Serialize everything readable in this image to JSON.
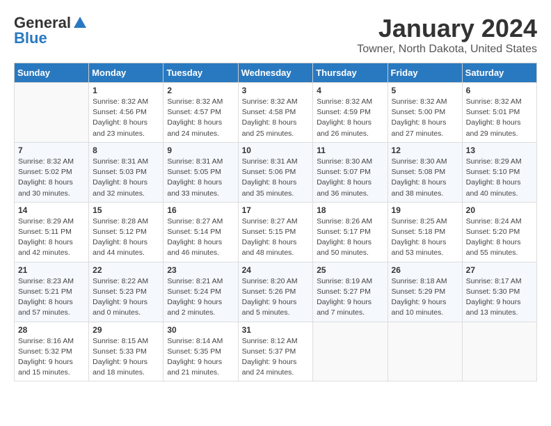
{
  "header": {
    "logo_line1": "General",
    "logo_line2": "Blue",
    "month": "January 2024",
    "location": "Towner, North Dakota, United States"
  },
  "weekdays": [
    "Sunday",
    "Monday",
    "Tuesday",
    "Wednesday",
    "Thursday",
    "Friday",
    "Saturday"
  ],
  "weeks": [
    [
      {
        "day": "",
        "sunrise": "",
        "sunset": "",
        "daylight": ""
      },
      {
        "day": "1",
        "sunrise": "Sunrise: 8:32 AM",
        "sunset": "Sunset: 4:56 PM",
        "daylight": "Daylight: 8 hours and 23 minutes."
      },
      {
        "day": "2",
        "sunrise": "Sunrise: 8:32 AM",
        "sunset": "Sunset: 4:57 PM",
        "daylight": "Daylight: 8 hours and 24 minutes."
      },
      {
        "day": "3",
        "sunrise": "Sunrise: 8:32 AM",
        "sunset": "Sunset: 4:58 PM",
        "daylight": "Daylight: 8 hours and 25 minutes."
      },
      {
        "day": "4",
        "sunrise": "Sunrise: 8:32 AM",
        "sunset": "Sunset: 4:59 PM",
        "daylight": "Daylight: 8 hours and 26 minutes."
      },
      {
        "day": "5",
        "sunrise": "Sunrise: 8:32 AM",
        "sunset": "Sunset: 5:00 PM",
        "daylight": "Daylight: 8 hours and 27 minutes."
      },
      {
        "day": "6",
        "sunrise": "Sunrise: 8:32 AM",
        "sunset": "Sunset: 5:01 PM",
        "daylight": "Daylight: 8 hours and 29 minutes."
      }
    ],
    [
      {
        "day": "7",
        "sunrise": "Sunrise: 8:32 AM",
        "sunset": "Sunset: 5:02 PM",
        "daylight": "Daylight: 8 hours and 30 minutes."
      },
      {
        "day": "8",
        "sunrise": "Sunrise: 8:31 AM",
        "sunset": "Sunset: 5:03 PM",
        "daylight": "Daylight: 8 hours and 32 minutes."
      },
      {
        "day": "9",
        "sunrise": "Sunrise: 8:31 AM",
        "sunset": "Sunset: 5:05 PM",
        "daylight": "Daylight: 8 hours and 33 minutes."
      },
      {
        "day": "10",
        "sunrise": "Sunrise: 8:31 AM",
        "sunset": "Sunset: 5:06 PM",
        "daylight": "Daylight: 8 hours and 35 minutes."
      },
      {
        "day": "11",
        "sunrise": "Sunrise: 8:30 AM",
        "sunset": "Sunset: 5:07 PM",
        "daylight": "Daylight: 8 hours and 36 minutes."
      },
      {
        "day": "12",
        "sunrise": "Sunrise: 8:30 AM",
        "sunset": "Sunset: 5:08 PM",
        "daylight": "Daylight: 8 hours and 38 minutes."
      },
      {
        "day": "13",
        "sunrise": "Sunrise: 8:29 AM",
        "sunset": "Sunset: 5:10 PM",
        "daylight": "Daylight: 8 hours and 40 minutes."
      }
    ],
    [
      {
        "day": "14",
        "sunrise": "Sunrise: 8:29 AM",
        "sunset": "Sunset: 5:11 PM",
        "daylight": "Daylight: 8 hours and 42 minutes."
      },
      {
        "day": "15",
        "sunrise": "Sunrise: 8:28 AM",
        "sunset": "Sunset: 5:12 PM",
        "daylight": "Daylight: 8 hours and 44 minutes."
      },
      {
        "day": "16",
        "sunrise": "Sunrise: 8:27 AM",
        "sunset": "Sunset: 5:14 PM",
        "daylight": "Daylight: 8 hours and 46 minutes."
      },
      {
        "day": "17",
        "sunrise": "Sunrise: 8:27 AM",
        "sunset": "Sunset: 5:15 PM",
        "daylight": "Daylight: 8 hours and 48 minutes."
      },
      {
        "day": "18",
        "sunrise": "Sunrise: 8:26 AM",
        "sunset": "Sunset: 5:17 PM",
        "daylight": "Daylight: 8 hours and 50 minutes."
      },
      {
        "day": "19",
        "sunrise": "Sunrise: 8:25 AM",
        "sunset": "Sunset: 5:18 PM",
        "daylight": "Daylight: 8 hours and 53 minutes."
      },
      {
        "day": "20",
        "sunrise": "Sunrise: 8:24 AM",
        "sunset": "Sunset: 5:20 PM",
        "daylight": "Daylight: 8 hours and 55 minutes."
      }
    ],
    [
      {
        "day": "21",
        "sunrise": "Sunrise: 8:23 AM",
        "sunset": "Sunset: 5:21 PM",
        "daylight": "Daylight: 8 hours and 57 minutes."
      },
      {
        "day": "22",
        "sunrise": "Sunrise: 8:22 AM",
        "sunset": "Sunset: 5:23 PM",
        "daylight": "Daylight: 9 hours and 0 minutes."
      },
      {
        "day": "23",
        "sunrise": "Sunrise: 8:21 AM",
        "sunset": "Sunset: 5:24 PM",
        "daylight": "Daylight: 9 hours and 2 minutes."
      },
      {
        "day": "24",
        "sunrise": "Sunrise: 8:20 AM",
        "sunset": "Sunset: 5:26 PM",
        "daylight": "Daylight: 9 hours and 5 minutes."
      },
      {
        "day": "25",
        "sunrise": "Sunrise: 8:19 AM",
        "sunset": "Sunset: 5:27 PM",
        "daylight": "Daylight: 9 hours and 7 minutes."
      },
      {
        "day": "26",
        "sunrise": "Sunrise: 8:18 AM",
        "sunset": "Sunset: 5:29 PM",
        "daylight": "Daylight: 9 hours and 10 minutes."
      },
      {
        "day": "27",
        "sunrise": "Sunrise: 8:17 AM",
        "sunset": "Sunset: 5:30 PM",
        "daylight": "Daylight: 9 hours and 13 minutes."
      }
    ],
    [
      {
        "day": "28",
        "sunrise": "Sunrise: 8:16 AM",
        "sunset": "Sunset: 5:32 PM",
        "daylight": "Daylight: 9 hours and 15 minutes."
      },
      {
        "day": "29",
        "sunrise": "Sunrise: 8:15 AM",
        "sunset": "Sunset: 5:33 PM",
        "daylight": "Daylight: 9 hours and 18 minutes."
      },
      {
        "day": "30",
        "sunrise": "Sunrise: 8:14 AM",
        "sunset": "Sunset: 5:35 PM",
        "daylight": "Daylight: 9 hours and 21 minutes."
      },
      {
        "day": "31",
        "sunrise": "Sunrise: 8:12 AM",
        "sunset": "Sunset: 5:37 PM",
        "daylight": "Daylight: 9 hours and 24 minutes."
      },
      {
        "day": "",
        "sunrise": "",
        "sunset": "",
        "daylight": ""
      },
      {
        "day": "",
        "sunrise": "",
        "sunset": "",
        "daylight": ""
      },
      {
        "day": "",
        "sunrise": "",
        "sunset": "",
        "daylight": ""
      }
    ]
  ]
}
